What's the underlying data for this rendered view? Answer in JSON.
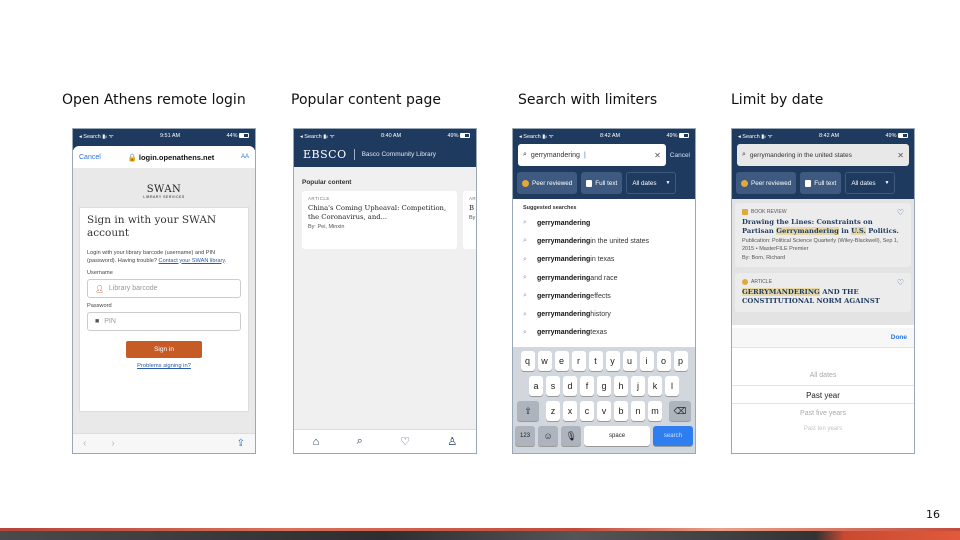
{
  "captions": [
    "Open Athens remote login",
    "Popular content page",
    "Search with limiters",
    "Limit by date"
  ],
  "page_number": "16",
  "phone1": {
    "status": {
      "left": "◂ Search ▮ᵢₗ ᯤ",
      "time": "9:51 AM",
      "battery": "44%"
    },
    "cancel": "Cancel",
    "url": "🔒 login.openathens.net",
    "text_size": "AA",
    "logo": "SWAN",
    "logo_sub": "LIBRARY SERVICES",
    "heading": "Sign in with your SWAN account",
    "intro": "Login with your library barcode (username) and PIN (password). Having trouble?",
    "intro_link": "Contact your SWAN library",
    "username_label": "Username",
    "username_placeholder": "Library barcode",
    "password_label": "Password",
    "password_placeholder": "PIN",
    "sign_in": "Sign in",
    "problems": "Problems signing in?",
    "back": "‹",
    "forward": "›",
    "share": "⇪"
  },
  "phone2": {
    "status": {
      "left": "◂ Search ▮ᵢₗ ᯤ",
      "time": "8:40 AM",
      "battery": "49%"
    },
    "brand": "EBSCO",
    "library": "Basco Community Library",
    "section_title": "Popular content",
    "cards": [
      {
        "type": "ARTICLE",
        "title": "China's Coming Upheaval: Competition, the Coronavirus, and...",
        "by": "By: Pei, Minxin"
      },
      {
        "type": "AR",
        "title": "B",
        "by": "By"
      }
    ],
    "nav": [
      "home",
      "search",
      "favorites",
      "account"
    ]
  },
  "phone3": {
    "status": {
      "left": "◂ Search ▮ᵢₗ ᯤ",
      "time": "8:42 AM",
      "battery": "49%"
    },
    "query": "gerrymandering",
    "cancel": "Cancel",
    "chips": {
      "peer": "Peer reviewed",
      "full": "Full text",
      "dates": "All dates"
    },
    "suggestions_title": "Suggested searches",
    "suggestions": [
      {
        "bold": "gerrymandering",
        "rest": ""
      },
      {
        "bold": "gerrymandering",
        "rest": " in the united states"
      },
      {
        "bold": "gerrymandering",
        "rest": " in texas"
      },
      {
        "bold": "gerrymandering",
        "rest": " and race"
      },
      {
        "bold": "gerrymandering",
        "rest": " effects"
      },
      {
        "bold": "gerrymandering",
        "rest": " history"
      },
      {
        "bold": "gerrymandering",
        "rest": " texas"
      }
    ],
    "keyboard": {
      "row1": [
        "q",
        "w",
        "e",
        "r",
        "t",
        "y",
        "u",
        "i",
        "o",
        "p"
      ],
      "row2": [
        "a",
        "s",
        "d",
        "f",
        "g",
        "h",
        "j",
        "k",
        "l"
      ],
      "row3": [
        "z",
        "x",
        "c",
        "v",
        "b",
        "n",
        "m"
      ],
      "numbers": "123",
      "space": "space",
      "search": "search"
    }
  },
  "phone4": {
    "status": {
      "left": "◂ Search ▮ᵢₗ ᯤ",
      "time": "8:42 AM",
      "battery": "49%"
    },
    "query": "gerrymandering in the united states",
    "chips": {
      "peer": "Peer reviewed",
      "full": "Full text",
      "dates": "All dates"
    },
    "results": [
      {
        "type": "BOOK REVIEW",
        "title_pre": "Drawing the Lines: Constraints on Partisan ",
        "title_mark": "Gerrymandering",
        "title_mid": " in ",
        "title_mark2": "U.S.",
        "title_post": " Politics.",
        "publication": "Publication: Political Science Quarterly (Wiley-Blackwell), Sep 1, 2015 • MasterFILE Premier",
        "by": "By: Born, Richard"
      },
      {
        "type": "ARTICLE",
        "title_pre": "",
        "title_mark": "GERRYMANDERING",
        "title_mid": " AND THE CONSTITUTIONAL NORM AGAINST",
        "title_mark2": "",
        "title_post": "",
        "publication": "",
        "by": ""
      }
    ],
    "done": "Done",
    "options": [
      "All dates",
      "Past year",
      "Past five years",
      "Past ten years"
    ],
    "selected": "Past year"
  }
}
